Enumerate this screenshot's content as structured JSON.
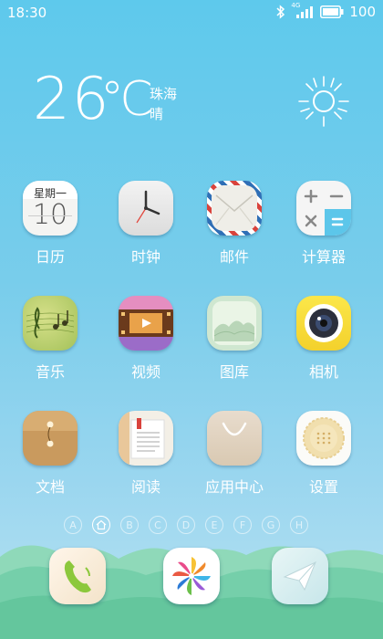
{
  "status_bar": {
    "time": "18:30",
    "signal_label": "4G",
    "battery": "100",
    "icons": [
      "bluetooth-icon",
      "signal-icon",
      "battery-icon"
    ]
  },
  "weather": {
    "temperature": "26",
    "unit": "℃",
    "city": "珠海",
    "condition": "晴",
    "icon": "sun-icon"
  },
  "apps": [
    {
      "label": "日历",
      "icon": "calendar-icon",
      "calendar_weekday": "星期一",
      "calendar_day": "10"
    },
    {
      "label": "时钟",
      "icon": "clock-icon"
    },
    {
      "label": "邮件",
      "icon": "mail-icon"
    },
    {
      "label": "计算器",
      "icon": "calculator-icon"
    },
    {
      "label": "音乐",
      "icon": "music-icon"
    },
    {
      "label": "视频",
      "icon": "video-icon"
    },
    {
      "label": "图库",
      "icon": "gallery-icon"
    },
    {
      "label": "相机",
      "icon": "camera-icon"
    },
    {
      "label": "文档",
      "icon": "document-icon"
    },
    {
      "label": "阅读",
      "icon": "reading-icon"
    },
    {
      "label": "应用中心",
      "icon": "app-center-icon"
    },
    {
      "label": "设置",
      "icon": "settings-icon"
    }
  ],
  "page_indicator": {
    "pages": [
      "A",
      "home",
      "B",
      "C",
      "D",
      "E",
      "F",
      "G",
      "H"
    ],
    "current": "home"
  },
  "dock": [
    {
      "name": "phone",
      "icon": "phone-icon"
    },
    {
      "name": "pinwheel",
      "icon": "pinwheel-icon"
    },
    {
      "name": "messages",
      "icon": "paper-plane-icon"
    }
  ],
  "colors": {
    "background_top": "#5ec9ec",
    "background_bottom": "#b7e2f2",
    "hills": "#7fd3b0"
  }
}
